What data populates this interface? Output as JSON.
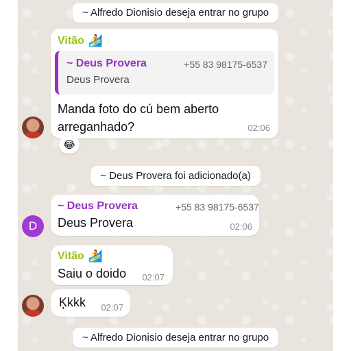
{
  "colors": {
    "vitao_name": "#9bbf1a",
    "deus_name": "#9b2fc4",
    "avatar_d_bg": "#a03ad0",
    "chat_bg": "#e9e4de"
  },
  "system_messages": [
    {
      "text": "~ Alfredo Dionisio deseja entrar no grupo"
    },
    {
      "text": "~ Deus Provera foi adicionado(a)"
    },
    {
      "text": "~ Alfredo Dionisio deseja entrar no grupo"
    }
  ],
  "msg1": {
    "sender": "Vitão",
    "sender_emoji": "🏄",
    "quote": {
      "author": "~ Deus Provera",
      "phone": "+55 83 98175-6537",
      "text": "Deus Provera"
    },
    "text_line1": "Manda foto do cú bem aberto",
    "text_line2": "arreganhado?",
    "time": "02:06",
    "reaction": "😂"
  },
  "msg2": {
    "avatar_letter": "D",
    "sender": "~ Deus Provera",
    "phone": "+55 83 98175-6537",
    "text": "Deus Provera",
    "time": "02:06"
  },
  "msg3": {
    "sender": "Vitão",
    "sender_emoji": "🏄",
    "text": "Saiu o doido",
    "time": "02:07"
  },
  "msg4": {
    "text": "Ķkkk",
    "time": "02:07"
  }
}
